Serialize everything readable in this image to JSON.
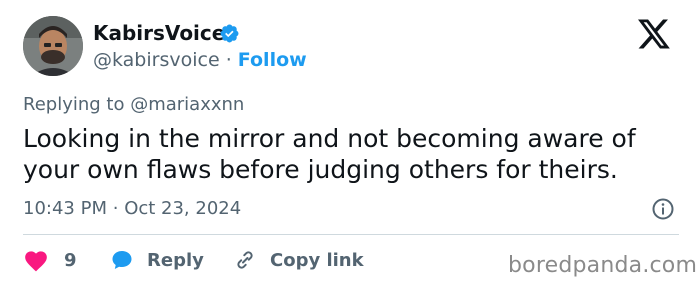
{
  "author": {
    "display_name": "KabirsVoice",
    "handle": "@kabirsvoice",
    "separator": "·",
    "follow_label": "Follow"
  },
  "tweet": {
    "replying_prefix": "Replying to",
    "replying_to": "@mariaxxnn",
    "text": "Looking in the mirror and not becoming aware of your own flaws before judging others for theirs.",
    "time": "10:43 PM",
    "date_separator": "·",
    "date": "Oct 23, 2024"
  },
  "actions": {
    "likes_count": "9",
    "reply_label": "Reply",
    "copy_link_label": "Copy link"
  },
  "watermark": "boredpanda.com",
  "colors": {
    "accent": "#1d9bf0",
    "like": "#f91880",
    "text": "#0f1419",
    "secondary": "#536471"
  },
  "icons": {
    "verified": "verified-badge-icon",
    "platform": "x-logo-icon",
    "info": "info-icon",
    "like": "heart-icon",
    "reply": "reply-bubble-icon",
    "copy": "link-icon"
  }
}
